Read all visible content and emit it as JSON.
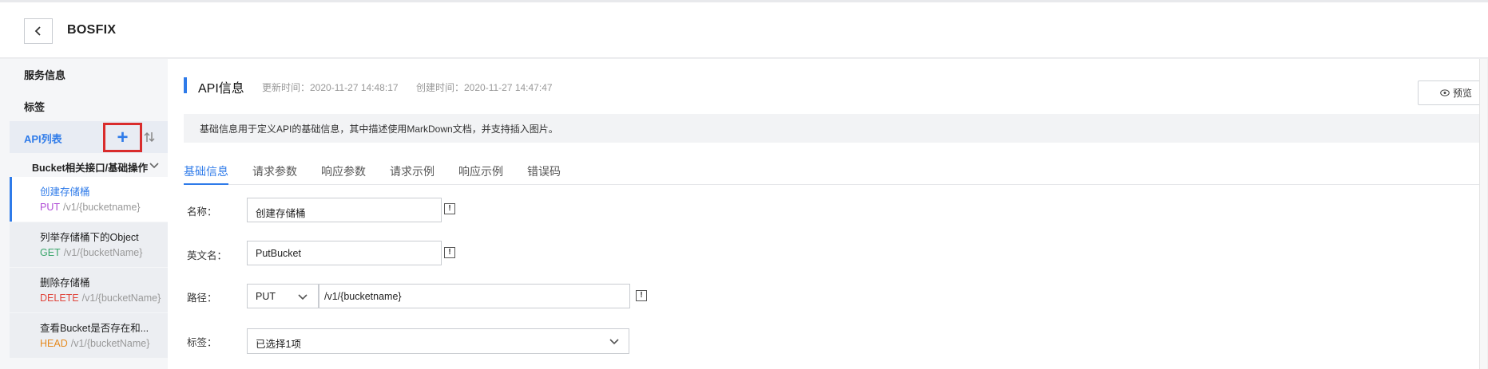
{
  "header": {
    "back_icon": "chevron-left-icon",
    "title": "BOSFIX"
  },
  "sidebar": {
    "service_info": "服务信息",
    "tags": "标签",
    "api_list": "API列表",
    "add_icon": "plus-icon",
    "sort_icon": "sort-icon",
    "group": "Bucket相关接口/基础操作",
    "items": [
      {
        "name": "创建存储桶",
        "method": "PUT",
        "path": "/v1/{bucketname}",
        "method_color": "#b04fd6"
      },
      {
        "name": "列举存储桶下的Object",
        "method": "GET",
        "path": "/v1/{bucketName}",
        "method_color": "#3aa66b"
      },
      {
        "name": "删除存储桶",
        "method": "DELETE",
        "path": "/v1/{bucketName}",
        "method_color": "#e0463d"
      },
      {
        "name": "查看Bucket是否存在和...",
        "method": "HEAD",
        "path": "/v1/{bucketName}",
        "method_color": "#e58a1f"
      }
    ]
  },
  "main": {
    "title": "API信息",
    "updated": "更新时间：2020-11-27 14:48:17",
    "created": "创建时间：2020-11-27 14:47:47",
    "preview": "预览",
    "info": "基础信息用于定义API的基础信息，其中描述使用MarkDown文档，并支持插入图片。",
    "tabs": [
      "基础信息",
      "请求参数",
      "响应参数",
      "请求示例",
      "响应示例",
      "错误码"
    ],
    "form": {
      "name_label": "名称：",
      "name_value": "创建存储桶",
      "en_label": "英文名：",
      "en_value": "PutBucket",
      "path_label": "路径：",
      "method_value": "PUT",
      "path_value": "/v1/{bucketname}",
      "tag_label": "标签：",
      "tag_value": "已选择1项",
      "info_mark": "!"
    }
  },
  "colors": {
    "accent": "#2f7be9",
    "highlight_border": "#d92c2c"
  }
}
